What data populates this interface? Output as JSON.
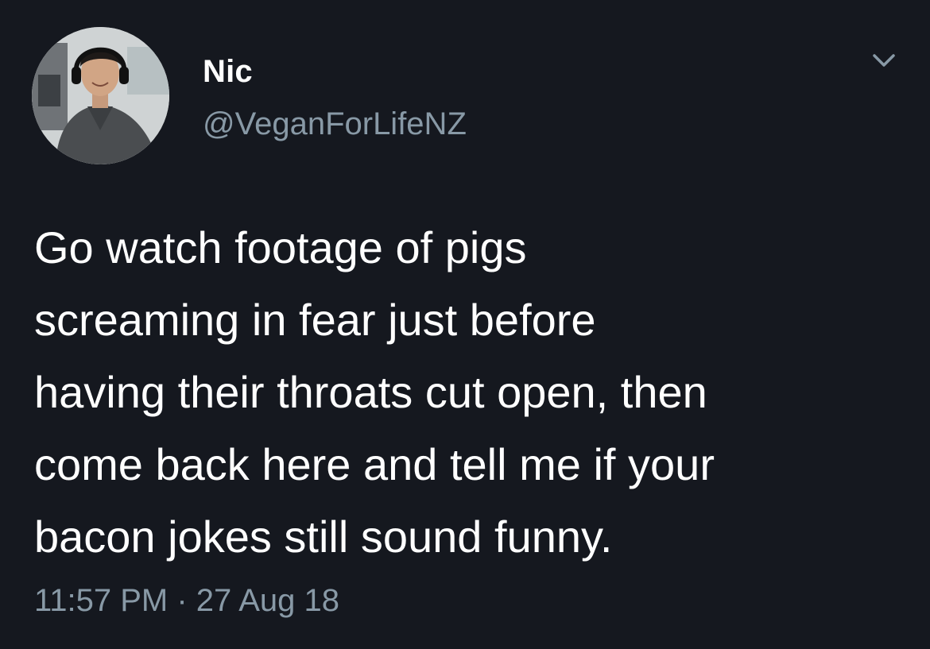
{
  "author": {
    "display_name": "Nic",
    "handle": "@VeganForLifeNZ",
    "avatar_icon": "profile-photo",
    "menu_icon": "chevron-down-icon"
  },
  "tweet": {
    "lines": [
      "Go watch footage of pigs",
      "screaming in fear just before",
      "having their throats cut open, then",
      "come back here and tell me if your",
      "bacon jokes still sound funny."
    ]
  },
  "meta": {
    "time": "11:57 PM",
    "separator": " · ",
    "date": "27 Aug 18"
  },
  "colors": {
    "background": "#15181f",
    "primary_text": "#ffffff",
    "secondary_text": "#8899a6"
  }
}
